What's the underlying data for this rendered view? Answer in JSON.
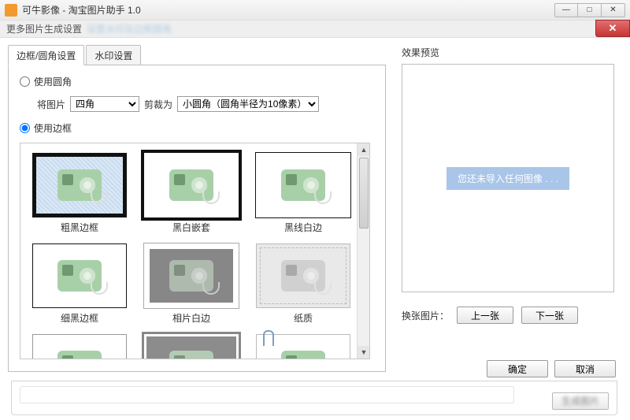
{
  "window": {
    "title": "可牛影像 - 淘宝图片助手 1.0"
  },
  "subheader": {
    "label": "更多图片生成设置"
  },
  "tabs": {
    "active": "边框/圆角设置",
    "inactive": "水印设置"
  },
  "options": {
    "use_round": "使用圆角",
    "use_border": "使用边框",
    "img_label": "将图片",
    "crop_label": "剪裁为",
    "corner_select": "四角",
    "crop_select": "小圆角（圆角半径为10像素）"
  },
  "frames": [
    {
      "label": "粗黑边框"
    },
    {
      "label": "黑白嵌套"
    },
    {
      "label": "黑线白边"
    },
    {
      "label": "细黑边框"
    },
    {
      "label": "相片白边"
    },
    {
      "label": "纸质"
    },
    {
      "label": ""
    },
    {
      "label": ""
    },
    {
      "label": ""
    }
  ],
  "preview": {
    "title": "效果预览",
    "empty_msg": "您还未导入任何图像 . . .",
    "swap_label": "换张图片：",
    "prev": "上一张",
    "next": "下一张"
  },
  "buttons": {
    "ok": "确定",
    "cancel": "取消"
  }
}
